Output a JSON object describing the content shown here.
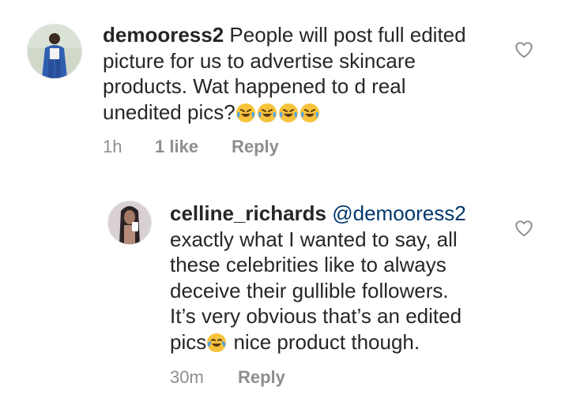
{
  "comments": [
    {
      "username": "demooress2",
      "text_lines": [
        "People will post full edited",
        "picture for us to advertise skincare",
        "products. Wat happened to d real",
        "unedited pics?"
      ],
      "emoji": [
        "rofl-emoji",
        "rofl-emoji",
        "rofl-emoji",
        "rofl-emoji"
      ],
      "time": "1h",
      "likes": "1 like",
      "reply_label": "Reply",
      "like_icon": "heart-outline-icon"
    }
  ],
  "replies": [
    {
      "username": "celline_richards",
      "mention": "@demooress2",
      "text_lines": [
        "exactly what I wanted to say, all",
        "these celebrities like to always",
        "deceive their gullible followers.",
        "It’s very obvious that’s an edited",
        "pics"
      ],
      "emoji": "joy-emoji",
      "text_tail": " nice product though.",
      "time": "30m",
      "reply_label": "Reply",
      "like_icon": "heart-outline-icon"
    }
  ],
  "colors": {
    "text": "#262626",
    "meta": "#8e8e8e",
    "mention": "#00376b",
    "emoji_face": "#f7c33c",
    "emoji_tears": "#4aa3f2"
  }
}
